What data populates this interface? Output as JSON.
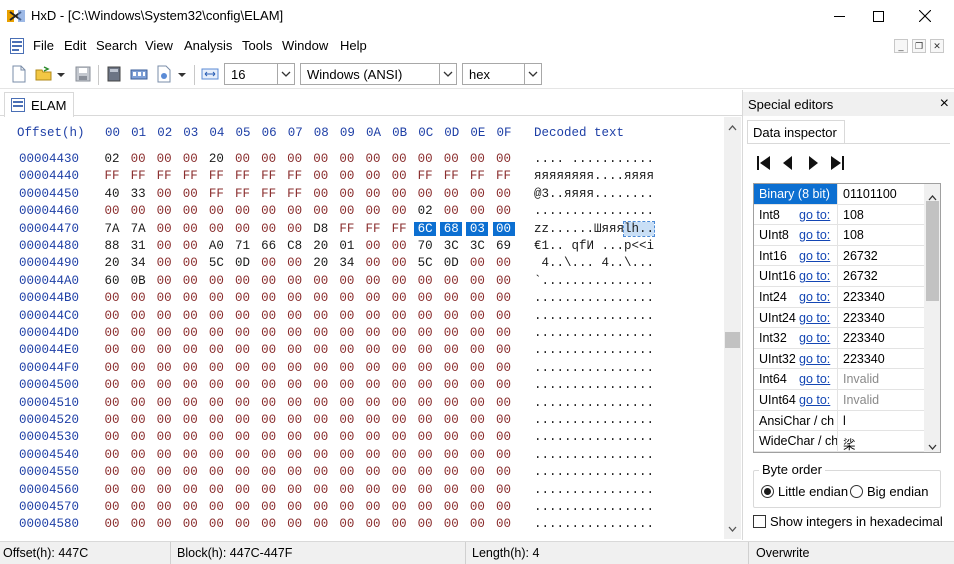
{
  "window": {
    "title": "HxD - [C:\\Windows\\System32\\config\\ELAM]"
  },
  "menu": {
    "items": [
      "File",
      "Edit",
      "Search",
      "View",
      "Analysis",
      "Tools",
      "Window",
      "Help"
    ]
  },
  "toolbar": {
    "bytes_per_row": "16",
    "charset": "Windows (ANSI)",
    "offset_base": "hex"
  },
  "document_tab": {
    "label": "ELAM"
  },
  "hex": {
    "offset_header": "Offset(h)",
    "column_headers": [
      "00",
      "01",
      "02",
      "03",
      "04",
      "05",
      "06",
      "07",
      "08",
      "09",
      "0A",
      "0B",
      "0C",
      "0D",
      "0E",
      "0F"
    ],
    "decoded_header": "Decoded text",
    "rows": [
      {
        "offset": "00004430",
        "bytes": [
          "02",
          "00",
          "00",
          "00",
          "20",
          "00",
          "00",
          "00",
          "00",
          "00",
          "00",
          "00",
          "00",
          "00",
          "00",
          "00"
        ],
        "decoded": ".... ..........."
      },
      {
        "offset": "00004440",
        "bytes": [
          "FF",
          "FF",
          "FF",
          "FF",
          "FF",
          "FF",
          "FF",
          "FF",
          "00",
          "00",
          "00",
          "00",
          "FF",
          "FF",
          "FF",
          "FF"
        ],
        "decoded": "яяяяяяяя....яяяя"
      },
      {
        "offset": "00004450",
        "bytes": [
          "40",
          "33",
          "00",
          "00",
          "FF",
          "FF",
          "FF",
          "FF",
          "00",
          "00",
          "00",
          "00",
          "00",
          "00",
          "00",
          "00"
        ],
        "decoded": "@3..яяяя........"
      },
      {
        "offset": "00004460",
        "bytes": [
          "00",
          "00",
          "00",
          "00",
          "00",
          "00",
          "00",
          "00",
          "00",
          "00",
          "00",
          "00",
          "02",
          "00",
          "00",
          "00"
        ],
        "decoded": "................"
      },
      {
        "offset": "00004470",
        "bytes": [
          "7A",
          "7A",
          "00",
          "00",
          "00",
          "00",
          "00",
          "00",
          "D8",
          "FF",
          "FF",
          "FF",
          "6C",
          "68",
          "03",
          "00"
        ],
        "decoded": "zz......Шяяяlh.."
      },
      {
        "offset": "00004480",
        "bytes": [
          "88",
          "31",
          "00",
          "00",
          "A0",
          "71",
          "66",
          "C8",
          "20",
          "01",
          "00",
          "00",
          "70",
          "3C",
          "3C",
          "69"
        ],
        "decoded": "€1.. qfИ ...p<<i"
      },
      {
        "offset": "00004490",
        "bytes": [
          "20",
          "34",
          "00",
          "00",
          "5C",
          "0D",
          "00",
          "00",
          "20",
          "34",
          "00",
          "00",
          "5C",
          "0D",
          "00",
          "00"
        ],
        "decoded": " 4..\\... 4..\\..."
      },
      {
        "offset": "000044A0",
        "bytes": [
          "60",
          "0B",
          "00",
          "00",
          "00",
          "00",
          "00",
          "00",
          "00",
          "00",
          "00",
          "00",
          "00",
          "00",
          "00",
          "00"
        ],
        "decoded": "`..............."
      },
      {
        "offset": "000044B0",
        "bytes": [
          "00",
          "00",
          "00",
          "00",
          "00",
          "00",
          "00",
          "00",
          "00",
          "00",
          "00",
          "00",
          "00",
          "00",
          "00",
          "00"
        ],
        "decoded": "................"
      },
      {
        "offset": "000044C0",
        "bytes": [
          "00",
          "00",
          "00",
          "00",
          "00",
          "00",
          "00",
          "00",
          "00",
          "00",
          "00",
          "00",
          "00",
          "00",
          "00",
          "00"
        ],
        "decoded": "................"
      },
      {
        "offset": "000044D0",
        "bytes": [
          "00",
          "00",
          "00",
          "00",
          "00",
          "00",
          "00",
          "00",
          "00",
          "00",
          "00",
          "00",
          "00",
          "00",
          "00",
          "00"
        ],
        "decoded": "................"
      },
      {
        "offset": "000044E0",
        "bytes": [
          "00",
          "00",
          "00",
          "00",
          "00",
          "00",
          "00",
          "00",
          "00",
          "00",
          "00",
          "00",
          "00",
          "00",
          "00",
          "00"
        ],
        "decoded": "................"
      },
      {
        "offset": "000044F0",
        "bytes": [
          "00",
          "00",
          "00",
          "00",
          "00",
          "00",
          "00",
          "00",
          "00",
          "00",
          "00",
          "00",
          "00",
          "00",
          "00",
          "00"
        ],
        "decoded": "................"
      },
      {
        "offset": "00004500",
        "bytes": [
          "00",
          "00",
          "00",
          "00",
          "00",
          "00",
          "00",
          "00",
          "00",
          "00",
          "00",
          "00",
          "00",
          "00",
          "00",
          "00"
        ],
        "decoded": "................"
      },
      {
        "offset": "00004510",
        "bytes": [
          "00",
          "00",
          "00",
          "00",
          "00",
          "00",
          "00",
          "00",
          "00",
          "00",
          "00",
          "00",
          "00",
          "00",
          "00",
          "00"
        ],
        "decoded": "................"
      },
      {
        "offset": "00004520",
        "bytes": [
          "00",
          "00",
          "00",
          "00",
          "00",
          "00",
          "00",
          "00",
          "00",
          "00",
          "00",
          "00",
          "00",
          "00",
          "00",
          "00"
        ],
        "decoded": "................"
      },
      {
        "offset": "00004530",
        "bytes": [
          "00",
          "00",
          "00",
          "00",
          "00",
          "00",
          "00",
          "00",
          "00",
          "00",
          "00",
          "00",
          "00",
          "00",
          "00",
          "00"
        ],
        "decoded": "................"
      },
      {
        "offset": "00004540",
        "bytes": [
          "00",
          "00",
          "00",
          "00",
          "00",
          "00",
          "00",
          "00",
          "00",
          "00",
          "00",
          "00",
          "00",
          "00",
          "00",
          "00"
        ],
        "decoded": "................"
      },
      {
        "offset": "00004550",
        "bytes": [
          "00",
          "00",
          "00",
          "00",
          "00",
          "00",
          "00",
          "00",
          "00",
          "00",
          "00",
          "00",
          "00",
          "00",
          "00",
          "00"
        ],
        "decoded": "................"
      },
      {
        "offset": "00004560",
        "bytes": [
          "00",
          "00",
          "00",
          "00",
          "00",
          "00",
          "00",
          "00",
          "00",
          "00",
          "00",
          "00",
          "00",
          "00",
          "00",
          "00"
        ],
        "decoded": "................"
      },
      {
        "offset": "00004570",
        "bytes": [
          "00",
          "00",
          "00",
          "00",
          "00",
          "00",
          "00",
          "00",
          "00",
          "00",
          "00",
          "00",
          "00",
          "00",
          "00",
          "00"
        ],
        "decoded": "................"
      },
      {
        "offset": "00004580",
        "bytes": [
          "00",
          "00",
          "00",
          "00",
          "00",
          "00",
          "00",
          "00",
          "00",
          "00",
          "00",
          "00",
          "00",
          "00",
          "00",
          "00"
        ],
        "decoded": "................"
      }
    ],
    "selection": {
      "row_offset": "00004470",
      "columns": [
        "0C",
        "0D",
        "0E",
        "0F"
      ]
    }
  },
  "special_editors": {
    "title": "Special editors",
    "tab": "Data inspector",
    "inspector": [
      {
        "name": "Binary (8 bit)",
        "goto": "",
        "value": "01101100",
        "selected": true
      },
      {
        "name": "Int8",
        "goto": "go to:",
        "value": "108"
      },
      {
        "name": "UInt8",
        "goto": "go to:",
        "value": "108"
      },
      {
        "name": "Int16",
        "goto": "go to:",
        "value": "26732"
      },
      {
        "name": "UInt16",
        "goto": "go to:",
        "value": "26732"
      },
      {
        "name": "Int24",
        "goto": "go to:",
        "value": "223340"
      },
      {
        "name": "UInt24",
        "goto": "go to:",
        "value": "223340"
      },
      {
        "name": "Int32",
        "goto": "go to:",
        "value": "223340"
      },
      {
        "name": "UInt32",
        "goto": "go to:",
        "value": "223340"
      },
      {
        "name": "Int64",
        "goto": "go to:",
        "value": "Invalid"
      },
      {
        "name": "UInt64",
        "goto": "go to:",
        "value": "Invalid"
      },
      {
        "name": "AnsiChar / ch",
        "goto": "",
        "value": "l"
      },
      {
        "name": "WideChar / ch",
        "goto": "",
        "value": "桬"
      }
    ],
    "byte_order": {
      "legend": "Byte order",
      "options": [
        "Little endian",
        "Big endian"
      ],
      "selected": "Little endian"
    },
    "hex_option_label": "Show integers in hexadecimal"
  },
  "status": {
    "offset": "Offset(h): 447C",
    "block": "Block(h): 447C-447F",
    "length": "Length(h): 4",
    "mode": "Overwrite"
  }
}
